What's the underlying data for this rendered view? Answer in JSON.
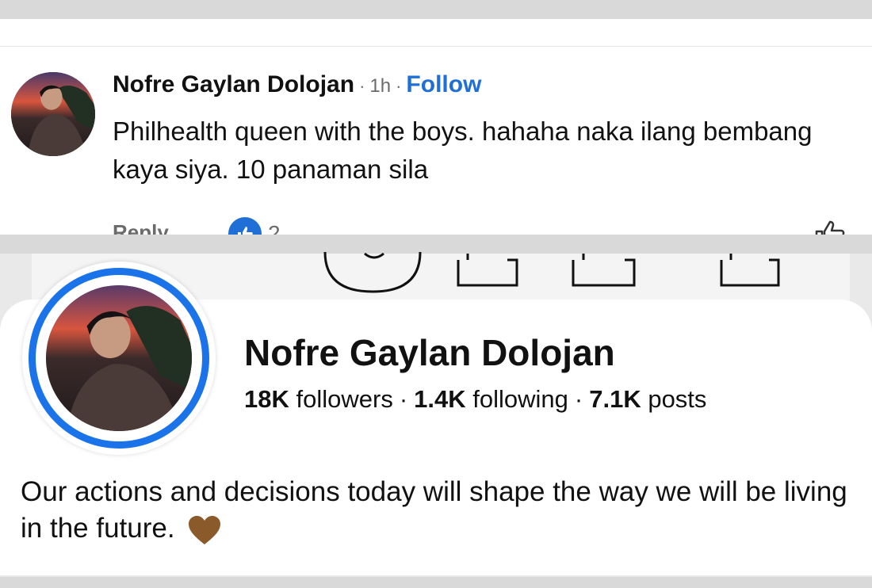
{
  "comment": {
    "author": "Nofre Gaylan Dolojan",
    "separator": "·",
    "time": "1h",
    "follow_label": "Follow",
    "text": "Philhealth queen with the boys. hahaha naka ilang bembang kaya siya. 10 panaman sila",
    "reply_label": "Reply",
    "reaction_icon": "thumbs-up-icon",
    "reaction_count": "2"
  },
  "profile": {
    "name": "Nofre Gaylan Dolojan",
    "stats": {
      "followers_value": "18K",
      "followers_label": "followers",
      "following_value": "1.4K",
      "following_label": "following",
      "posts_value": "7.1K",
      "posts_label": "posts",
      "separator": "·"
    },
    "bio": "Our actions and decisions today will shape the way we will be living in the future.",
    "bio_emoji": "brown-heart-icon"
  },
  "colors": {
    "accent_blue": "#1f6fd6",
    "avatar_ring": "#1a73e8",
    "heart_brown": "#8b5a2b",
    "muted_text": "#6b6b6b"
  }
}
